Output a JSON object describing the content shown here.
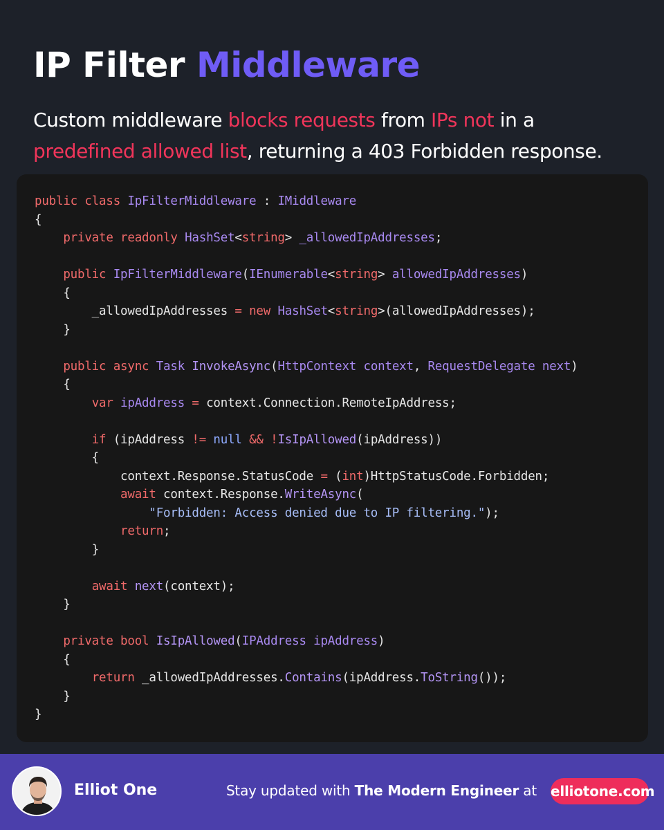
{
  "title": {
    "part1": "IP Filter",
    "part2": "Middleware"
  },
  "subtitle": {
    "segments": [
      {
        "text": "Custom middleware ",
        "highlight": false
      },
      {
        "text": "blocks requests",
        "highlight": true
      },
      {
        "text": " from ",
        "highlight": false
      },
      {
        "text": "IPs not",
        "highlight": true
      },
      {
        "text": " in a",
        "highlight": false
      },
      {
        "text": "\n",
        "highlight": false
      },
      {
        "text": "predefined allowed list",
        "highlight": true
      },
      {
        "text": ", returning a 403 Forbidden response.",
        "highlight": false
      }
    ]
  },
  "code_lines": [
    [
      [
        "kw",
        "public class "
      ],
      [
        "type",
        "IpFilterMiddleware"
      ],
      [
        "p",
        " : "
      ],
      [
        "type",
        "IMiddleware"
      ]
    ],
    [
      [
        "p",
        "{"
      ]
    ],
    [
      [
        "p",
        "    "
      ],
      [
        "kw",
        "private readonly "
      ],
      [
        "type",
        "HashSet"
      ],
      [
        "p",
        "<"
      ],
      [
        "kw",
        "string"
      ],
      [
        "p",
        "> "
      ],
      [
        "type",
        "_allowedIpAddresses"
      ],
      [
        "p",
        ";"
      ]
    ],
    [],
    [
      [
        "p",
        "    "
      ],
      [
        "kw",
        "public "
      ],
      [
        "type",
        "IpFilterMiddleware"
      ],
      [
        "p",
        "("
      ],
      [
        "type",
        "IEnumerable"
      ],
      [
        "p",
        "<"
      ],
      [
        "kw",
        "string"
      ],
      [
        "p",
        "> "
      ],
      [
        "type",
        "allowedIpAddresses"
      ],
      [
        "p",
        ")"
      ]
    ],
    [
      [
        "p",
        "    {"
      ]
    ],
    [
      [
        "p",
        "        _allowedIpAddresses "
      ],
      [
        "kw",
        "="
      ],
      [
        "p",
        " "
      ],
      [
        "kw",
        "new "
      ],
      [
        "type",
        "HashSet"
      ],
      [
        "p",
        "<"
      ],
      [
        "kw",
        "string"
      ],
      [
        "p",
        ">(allowedIpAddresses);"
      ]
    ],
    [
      [
        "p",
        "    }"
      ]
    ],
    [],
    [
      [
        "p",
        "    "
      ],
      [
        "kw",
        "public async "
      ],
      [
        "type",
        "Task "
      ],
      [
        "fn",
        "InvokeAsync"
      ],
      [
        "p",
        "("
      ],
      [
        "type",
        "HttpContext context"
      ],
      [
        "p",
        ", "
      ],
      [
        "type",
        "RequestDelegate next"
      ],
      [
        "p",
        ")"
      ]
    ],
    [
      [
        "p",
        "    {"
      ]
    ],
    [
      [
        "p",
        "        "
      ],
      [
        "kw",
        "var "
      ],
      [
        "type",
        "ipAddress"
      ],
      [
        "p",
        " "
      ],
      [
        "kw",
        "="
      ],
      [
        "p",
        " context.Connection.RemoteIpAddress;"
      ]
    ],
    [],
    [
      [
        "p",
        "        "
      ],
      [
        "kw",
        "if"
      ],
      [
        "p",
        " (ipAddress "
      ],
      [
        "kw",
        "!="
      ],
      [
        "p",
        " "
      ],
      [
        "null",
        "null"
      ],
      [
        "p",
        " "
      ],
      [
        "kw",
        "&&"
      ],
      [
        "p",
        " "
      ],
      [
        "kw",
        "!"
      ],
      [
        "fn",
        "IsIpAllowed"
      ],
      [
        "p",
        "(ipAddress))"
      ]
    ],
    [
      [
        "p",
        "        {"
      ]
    ],
    [
      [
        "p",
        "            context.Response.StatusCode "
      ],
      [
        "kw",
        "="
      ],
      [
        "p",
        " ("
      ],
      [
        "kw",
        "int"
      ],
      [
        "p",
        ")HttpStatusCode.Forbidden;"
      ]
    ],
    [
      [
        "p",
        "            "
      ],
      [
        "kw",
        "await"
      ],
      [
        "p",
        " context.Response."
      ],
      [
        "fn",
        "WriteAsync"
      ],
      [
        "p",
        "("
      ]
    ],
    [
      [
        "p",
        "                "
      ],
      [
        "str",
        "\"Forbidden: Access denied due to IP filtering.\""
      ],
      [
        "p",
        ");"
      ]
    ],
    [
      [
        "p",
        "            "
      ],
      [
        "kw",
        "return"
      ],
      [
        "p",
        ";"
      ]
    ],
    [
      [
        "p",
        "        }"
      ]
    ],
    [],
    [
      [
        "p",
        "        "
      ],
      [
        "kw",
        "await "
      ],
      [
        "fn",
        "next"
      ],
      [
        "p",
        "(context);"
      ]
    ],
    [
      [
        "p",
        "    }"
      ]
    ],
    [],
    [
      [
        "p",
        "    "
      ],
      [
        "kw",
        "private bool "
      ],
      [
        "fn",
        "IsIpAllowed"
      ],
      [
        "p",
        "("
      ],
      [
        "type",
        "IPAddress ipAddress"
      ],
      [
        "p",
        ")"
      ]
    ],
    [
      [
        "p",
        "    {"
      ]
    ],
    [
      [
        "p",
        "        "
      ],
      [
        "kw",
        "return"
      ],
      [
        "p",
        " _allowedIpAddresses."
      ],
      [
        "fn",
        "Contains"
      ],
      [
        "p",
        "(ipAddress."
      ],
      [
        "fn",
        "ToString"
      ],
      [
        "p",
        "());"
      ]
    ],
    [
      [
        "p",
        "    }"
      ]
    ],
    [
      [
        "p",
        "}"
      ]
    ]
  ],
  "footer": {
    "author": "Elliot One",
    "cta_prefix": "Stay updated with ",
    "cta_brand": "The Modern Engineer",
    "cta_suffix": " at",
    "site": "elliotone.com"
  },
  "colors": {
    "background": "#1d2129",
    "accent_purple": "#6f5cf6",
    "highlight_red": "#f0355a",
    "footer_bg": "#4b3fab",
    "pill": "#ee2d5b"
  }
}
